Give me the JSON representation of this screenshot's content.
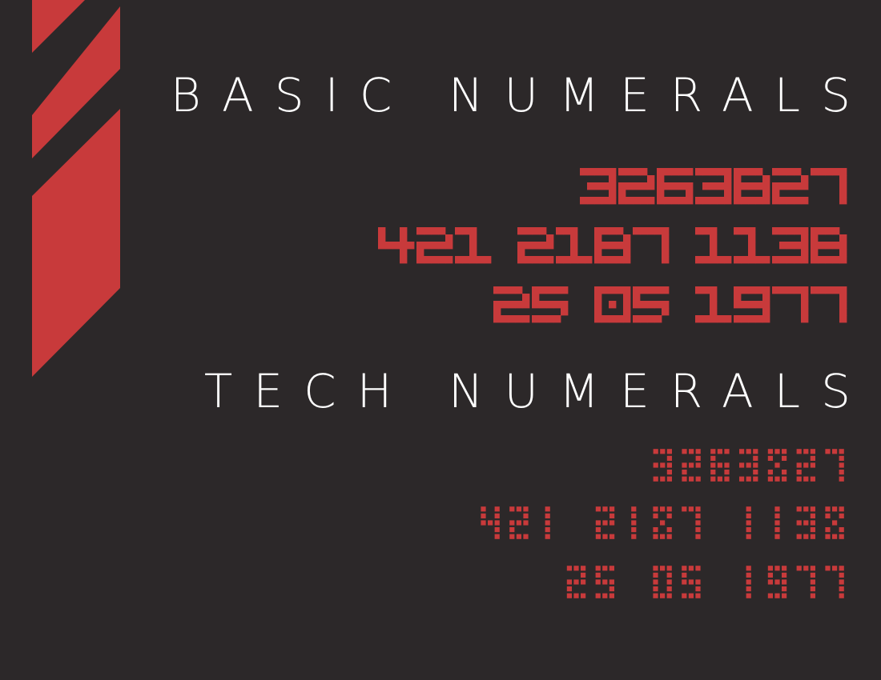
{
  "colors": {
    "background": "#2c2829",
    "accent": "#c83a3b",
    "text": "#ffffff"
  },
  "basic_numerals": {
    "title": "BASIC NUMERALS",
    "lines": [
      "3263827",
      "421 2187 1138",
      "25 05 1977"
    ]
  },
  "tech_numerals": {
    "title": "TECH NUMERALS",
    "lines": [
      "3263827",
      "421 2187 1138",
      "25 05 1977"
    ]
  }
}
